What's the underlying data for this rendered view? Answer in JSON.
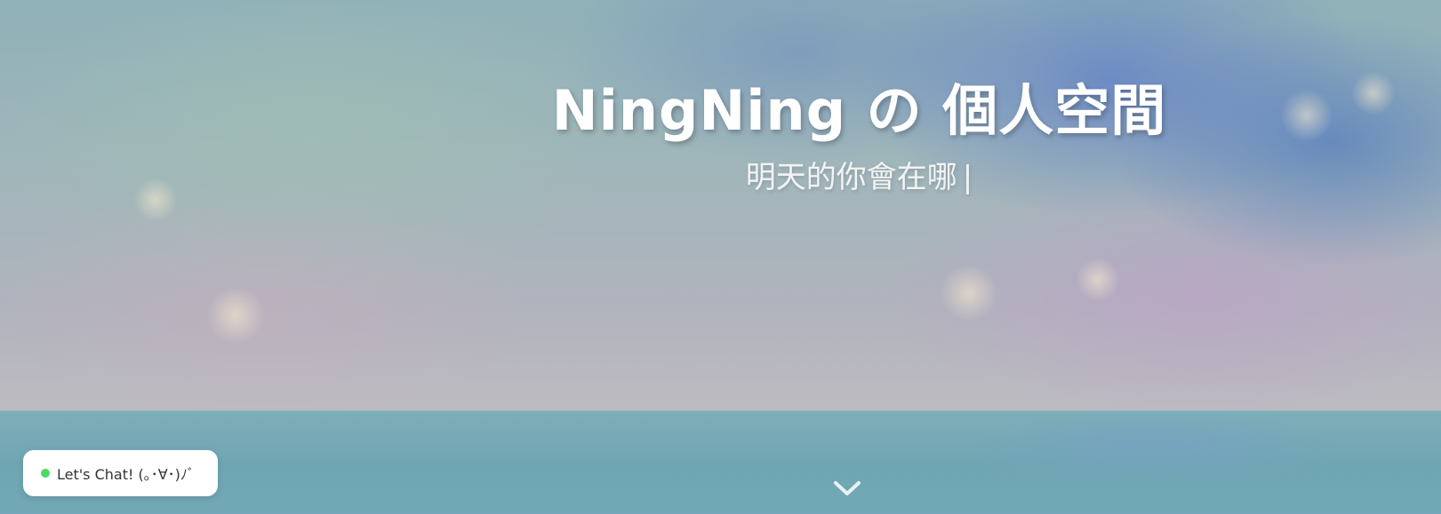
{
  "hero": {
    "title": "NingNing の 個人空間",
    "subtitle": "明天的你會在哪",
    "cursor_glyph": "|"
  },
  "scroll_down": {
    "icon": "chevron-down-icon"
  },
  "chat_widget": {
    "label": "Let's Chat! (｡･∀･)ﾉﾞ",
    "status_color": "#4cd964",
    "icon": "online-status-dot"
  },
  "colors": {
    "title_text": "#ffffff",
    "subtitle_text": "#f2f3f5",
    "chat_bg": "#ffffff"
  }
}
